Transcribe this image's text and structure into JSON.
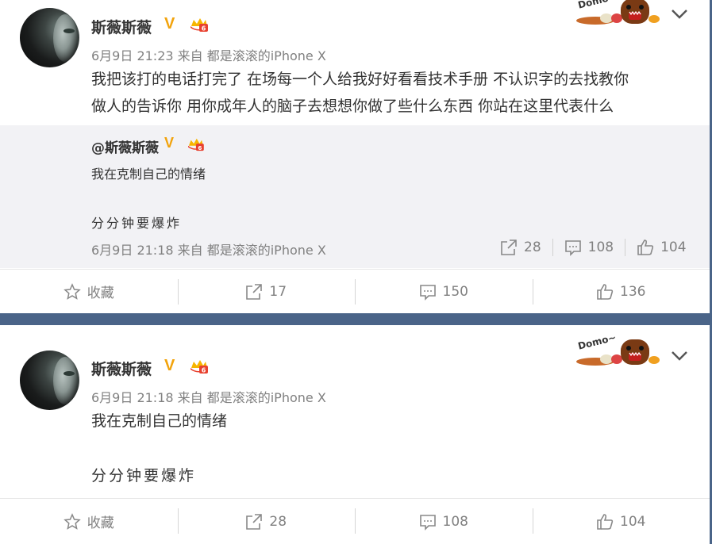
{
  "post1": {
    "username": "斯薇斯薇",
    "verified_badge": "V",
    "meta": "6月9日 21:23 来自 都是滚滚的iPhone X",
    "text_line1": "我把该打的电话打完了 在场每一个人给我好好看看技术手册 不认识字的去找教你",
    "text_line2": "做人的告诉你 用你成年人的脑子去想想你做了些什么东西 你站在这里代表什么",
    "sticker_text": "Domo~",
    "repost": {
      "username": "@斯薇斯薇",
      "verified_badge": "V",
      "text_line1": "我在克制自己的情绪",
      "text_line2": "分分钟要爆炸",
      "meta": "6月9日 21:18 来自 都是滚滚的iPhone X",
      "repost_count": "28",
      "comment_count": "108",
      "like_count": "104"
    },
    "actions": {
      "favorite_label": "收藏",
      "repost_count": "17",
      "comment_count": "150",
      "like_count": "136"
    }
  },
  "post2": {
    "username": "斯薇斯薇",
    "verified_badge": "V",
    "meta": "6月9日 21:18 来自 都是滚滚的iPhone X",
    "text_line1": "我在克制自己的情绪",
    "text_line2": "分分钟要爆炸",
    "sticker_text": "Domo~",
    "actions": {
      "favorite_label": "收藏",
      "repost_count": "28",
      "comment_count": "108",
      "like_count": "104"
    }
  },
  "colors": {
    "background_band": "#4a6488",
    "verified": "#f2a30c",
    "repost_bg": "#f2f2f5",
    "muted_text": "#808080"
  },
  "icons": [
    "star-icon",
    "repost-icon",
    "comment-icon",
    "like-icon",
    "chevron-down-icon",
    "member-badge-icon"
  ]
}
